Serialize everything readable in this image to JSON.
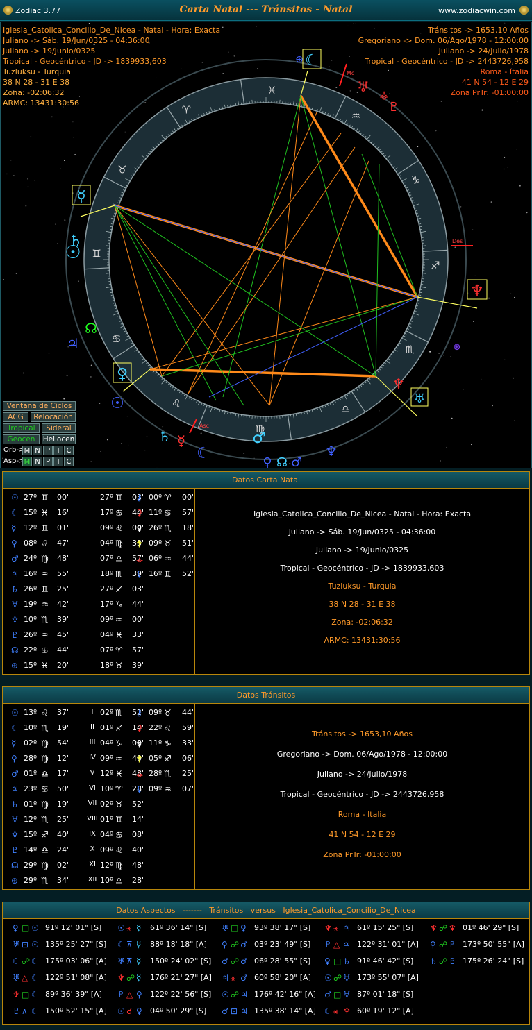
{
  "window": {
    "app_name": "Zodiac 3.77",
    "title": "Carta Natal --- Tránsitos - Natal",
    "site": "www.zodiacwin.com"
  },
  "natal_info": [
    "Iglesia_Catolica_Concilio_De_Nicea - Natal - Hora: Exacta",
    "Juliano -> Sáb. 19/Jun/0325 - 04:36:00",
    "Juliano -> 19/Junio/0325",
    "Tropical - Geocéntrico - JD -> 1839933,603",
    "Tuzluksu - Turquia",
    "38 N 28 - 31 E 38",
    "Zona: -02:06:32",
    "ARMC: 13431:30:56"
  ],
  "transit_info": [
    "Tránsitos -> 1653,10 Años",
    "Gregoriano -> Dom. 06/Ago/1978 - 12:00:00",
    "Juliano -> 24/Julio/1978",
    "Tropical - Geocéntrico - JD -> 2443726,958",
    "Roma - Italia",
    "41 N 54 - 12 E 29",
    "Zona PrTr: -01:00:00"
  ],
  "wheel_labels": {
    "mc": "Mc",
    "asc": "Asc",
    "des": "Des"
  },
  "controls": {
    "ventana": "Ventana de Ciclos",
    "acg": "ACG",
    "relocacion": "Relocación",
    "tropical": "Tropical",
    "sideral": "Sideral",
    "geocen": "Geocen",
    "heliocen": "Heliocen",
    "orb_label": "Orb->",
    "asp_label": "Asp->",
    "letters": [
      "M",
      "N",
      "P",
      "T",
      "C"
    ]
  },
  "natal_panel": {
    "title": "Datos Carta Natal",
    "rows": [
      [
        {
          "g": "☉",
          "c": "#4080ff",
          "d": "27º",
          "s": "♊",
          "m": "00'"
        },
        {
          "d": "27º",
          "s": "♊",
          "m": "03'"
        },
        {
          "g": "⚷",
          "c": "#4080ff",
          "d": "00º",
          "s": "♈",
          "m": "00'"
        }
      ],
      [
        {
          "g": "☾",
          "c": "#4080ff",
          "d": "15º",
          "s": "♓",
          "m": "16'"
        },
        {
          "d": "17º",
          "s": "♋",
          "m": "44'"
        },
        {
          "g": "⚳",
          "c": "#ff3030",
          "d": "11º",
          "s": "♋",
          "m": "57'"
        }
      ],
      [
        {
          "g": "☿",
          "c": "#4080ff",
          "d": "12º",
          "s": "♊",
          "m": "01'"
        },
        {
          "d": "09º",
          "s": "♌",
          "m": "00'"
        },
        {
          "g": "⚴",
          "c": "#ffffff",
          "d": "26º",
          "s": "♏",
          "m": "18'"
        }
      ],
      [
        {
          "g": "♀",
          "c": "#4080ff",
          "d": "08º",
          "s": "♌",
          "m": "47'"
        },
        {
          "d": "04º",
          "s": "♍",
          "m": "33'"
        },
        {
          "g": "⚵",
          "c": "#ffff40",
          "d": "09º",
          "s": "♉",
          "m": "51'"
        }
      ],
      [
        {
          "g": "♂",
          "c": "#4080ff",
          "d": "24º",
          "s": "♍",
          "m": "48'"
        },
        {
          "d": "07º",
          "s": "♎",
          "m": "57'"
        },
        {
          "g": "⚶",
          "c": "#ff3030",
          "d": "06º",
          "s": "♒",
          "m": "44'"
        }
      ],
      [
        {
          "g": "♃",
          "c": "#4080ff",
          "d": "16º",
          "s": "♒",
          "m": "55'"
        },
        {
          "d": "18º",
          "s": "♏",
          "m": "39'"
        },
        {
          "g": "⚸",
          "c": "#4080ff",
          "d": "16º",
          "s": "♊",
          "m": "52'"
        }
      ],
      [
        {
          "g": "♄",
          "c": "#4080ff",
          "d": "26º",
          "s": "♊",
          "m": "25'"
        },
        {
          "d": "27º",
          "s": "♐",
          "m": "03'"
        }
      ],
      [
        {
          "g": "♅",
          "c": "#4080ff",
          "d": "19º",
          "s": "♒",
          "m": "42'"
        },
        {
          "d": "17º",
          "s": "♑",
          "m": "44'"
        }
      ],
      [
        {
          "g": "♆",
          "c": "#4080ff",
          "d": "10º",
          "s": "♏",
          "m": "39'"
        },
        {
          "d": "09º",
          "s": "♒",
          "m": "00'"
        }
      ],
      [
        {
          "g": "♇",
          "c": "#4080ff",
          "d": "26º",
          "s": "♒",
          "m": "45'"
        },
        {
          "d": "04º",
          "s": "♓",
          "m": "33'"
        }
      ],
      [
        {
          "g": "☊",
          "c": "#4080ff",
          "d": "22º",
          "s": "♋",
          "m": "44'"
        },
        {
          "d": "07º",
          "s": "♈",
          "m": "57'"
        }
      ],
      [
        {
          "g": "⊕",
          "c": "#4080ff",
          "d": "15º",
          "s": "♓",
          "m": "20'"
        },
        {
          "d": "18º",
          "s": "♉",
          "m": "39'"
        }
      ]
    ],
    "info": [
      "Iglesia_Catolica_Concilio_De_Nicea - Natal - Hora: Exacta",
      "Juliano -> Sáb. 19/Jun/0325 - 04:36:00",
      "Juliano -> 19/Junio/0325",
      "Tropical - Geocéntrico - JD -> 1839933,603",
      "Tuzluksu - Turquia",
      "38 N 28 - 31 E 38",
      "Zona: -02:06:32",
      "ARMC: 13431:30:56"
    ]
  },
  "transit_panel": {
    "title": "Datos Tránsitos",
    "rows": [
      [
        {
          "g": "☉",
          "c": "#4080ff",
          "d": "13º",
          "s": "♌",
          "m": "37'"
        },
        {
          "h": "I",
          "d": "02º",
          "s": "♏",
          "m": "52'"
        },
        {
          "g": "⚷",
          "c": "#4080ff",
          "d": "09º",
          "s": "♉",
          "m": "44'"
        }
      ],
      [
        {
          "g": "☾",
          "c": "#4080ff",
          "d": "10º",
          "s": "♏",
          "m": "19'"
        },
        {
          "h": "II",
          "d": "01º",
          "s": "♐",
          "m": "14'"
        },
        {
          "g": "⚳",
          "c": "#ff3030",
          "d": "22º",
          "s": "♌",
          "m": "59'"
        }
      ],
      [
        {
          "g": "☿",
          "c": "#4080ff",
          "d": "02º",
          "s": "♍",
          "m": "54'"
        },
        {
          "h": "III",
          "d": "04º",
          "s": "♑",
          "m": "08'"
        },
        {
          "g": "⚴",
          "c": "#ffffff",
          "d": "11º",
          "s": "♑",
          "m": "33'"
        }
      ],
      [
        {
          "g": "♀",
          "c": "#4080ff",
          "d": "28º",
          "s": "♍",
          "m": "12'"
        },
        {
          "h": "IV",
          "d": "09º",
          "s": "♒",
          "m": "40'"
        },
        {
          "g": "⚵",
          "c": "#ffff40",
          "d": "05º",
          "s": "♐",
          "m": "06'"
        }
      ],
      [
        {
          "g": "♂",
          "c": "#4080ff",
          "d": "01º",
          "s": "♎",
          "m": "17'"
        },
        {
          "h": "V",
          "d": "12º",
          "s": "♓",
          "m": "48'"
        },
        {
          "g": "⚶",
          "c": "#ff3030",
          "d": "28º",
          "s": "♏",
          "m": "25'"
        }
      ],
      [
        {
          "g": "♃",
          "c": "#4080ff",
          "d": "23º",
          "s": "♋",
          "m": "50'"
        },
        {
          "h": "VI",
          "d": "10º",
          "s": "♈",
          "m": "28'"
        },
        {
          "g": "⚸",
          "c": "#4080ff",
          "d": "09º",
          "s": "♒",
          "m": "07'"
        }
      ],
      [
        {
          "g": "♄",
          "c": "#4080ff",
          "d": "01º",
          "s": "♍",
          "m": "19'"
        },
        {
          "h": "VII",
          "d": "02º",
          "s": "♉",
          "m": "52'"
        }
      ],
      [
        {
          "g": "♅",
          "c": "#4080ff",
          "d": "12º",
          "s": "♏",
          "m": "25'"
        },
        {
          "h": "VIII",
          "d": "01º",
          "s": "♊",
          "m": "14'"
        }
      ],
      [
        {
          "g": "♆",
          "c": "#4080ff",
          "d": "15º",
          "s": "♐",
          "m": "40'"
        },
        {
          "h": "IX",
          "d": "04º",
          "s": "♋",
          "m": "08'"
        }
      ],
      [
        {
          "g": "♇",
          "c": "#4080ff",
          "d": "14º",
          "s": "♎",
          "m": "24'"
        },
        {
          "h": "X",
          "d": "09º",
          "s": "♌",
          "m": "40'"
        }
      ],
      [
        {
          "g": "☊",
          "c": "#4080ff",
          "d": "29º",
          "s": "♍",
          "m": "02'"
        },
        {
          "h": "XI",
          "d": "12º",
          "s": "♍",
          "m": "48'"
        }
      ],
      [
        {
          "g": "⊕",
          "c": "#4080ff",
          "d": "29º",
          "s": "♏",
          "m": "34'"
        },
        {
          "h": "XII",
          "d": "10º",
          "s": "♎",
          "m": "28'"
        }
      ]
    ],
    "info": [
      "Tránsitos -> 1653,10 Años",
      "Gregoriano -> Dom. 06/Ago/1978 - 12:00:00",
      "Juliano -> 24/Julio/1978",
      "Tropical - Geocéntrico - JD -> 2443726,958",
      "Roma - Italia",
      "41 N 54 - 12 E 29",
      "Zona PrTr: -01:00:00"
    ]
  },
  "aspects_panel": {
    "title": "Datos Aspectos   -------   Tránsitos   versus   Iglesia_Catolica_Concilio_De_Nicea",
    "columns": [
      [
        {
          "a": "♀",
          "b": "□",
          "c": "☉",
          "v": "91º 12' 01\" [S]"
        },
        {
          "a": "♅",
          "b": "⊡",
          "c": "☉",
          "v": "135º 25' 27\" [S]"
        },
        {
          "a": "☾",
          "b": "☍",
          "c": "☾",
          "v": "175º 03' 06\" [A]"
        },
        {
          "a": "♅",
          "b": "△",
          "c": "☾",
          "v": "122º 51' 08\" [A]"
        },
        {
          "a": "♆",
          "b": "□",
          "c": "☾",
          "v": "89º 36' 39\" [A]"
        },
        {
          "a": "♇",
          "b": "⊼",
          "c": "☾",
          "v": "150º 52' 15\" [A]"
        }
      ],
      [
        {
          "a": "☉",
          "b": "⚹",
          "c": "☿",
          "v": "61º 36' 14\" [S]"
        },
        {
          "a": "☾",
          "b": "⊼",
          "c": "☿",
          "v": "88º 18' 18\" [A]"
        },
        {
          "a": "♅",
          "b": "⊼",
          "c": "☿",
          "v": "150º 24' 02\" [S]"
        },
        {
          "a": "♆",
          "b": "☍",
          "c": "☿",
          "v": "176º 21' 27\" [A]"
        },
        {
          "a": "♇",
          "b": "△",
          "c": "♀",
          "v": "122º 22' 56\" [S]"
        },
        {
          "a": "☉",
          "b": "☌",
          "c": "♀",
          "v": "04º 50' 29\" [S]"
        }
      ],
      [
        {
          "a": "♅",
          "b": "□",
          "c": "♀",
          "v": "93º 38' 17\" [S]"
        },
        {
          "a": "♀",
          "b": "☍",
          "c": "♂",
          "v": "03º 23' 49\" [S]"
        },
        {
          "a": "♂",
          "b": "☍",
          "c": "♂",
          "v": "06º 28' 55\" [S]"
        },
        {
          "a": "♃",
          "b": "⚹",
          "c": "♂",
          "v": "60º 58' 20\" [A]"
        },
        {
          "a": "☉",
          "b": "☍",
          "c": "♃",
          "v": "176º 42' 16\" [A]"
        },
        {
          "a": "♂",
          "b": "⊡",
          "c": "♃",
          "v": "135º 38' 14\" [A]"
        }
      ],
      [
        {
          "a": "♆",
          "b": "⚹",
          "c": "♃",
          "v": "61º 15' 25\" [S]"
        },
        {
          "a": "♇",
          "b": "△",
          "c": "♃",
          "v": "122º 31' 01\" [A]"
        },
        {
          "a": "♀",
          "b": "□",
          "c": "♄",
          "v": "91º 46' 42\" [S]"
        },
        {
          "a": "☉",
          "b": "☍",
          "c": "♅",
          "v": "173º 55' 07\" [A]"
        },
        {
          "a": "♂",
          "b": "□",
          "c": "♅",
          "v": "87º 01' 18\" [S]"
        },
        {
          "a": "☾",
          "b": "⚹",
          "c": "♆",
          "v": "60º 19' 12\" [A]"
        }
      ],
      [
        {
          "a": "♆",
          "b": "☍",
          "c": "♆",
          "v": "01º 46' 29\" [S]"
        },
        {
          "a": "♀",
          "b": "☍",
          "c": "♇",
          "v": "173º 50' 55\" [A]"
        },
        {
          "a": "♄",
          "b": "☍",
          "c": "♇",
          "v": "175º 26' 24\" [S]"
        }
      ]
    ]
  }
}
